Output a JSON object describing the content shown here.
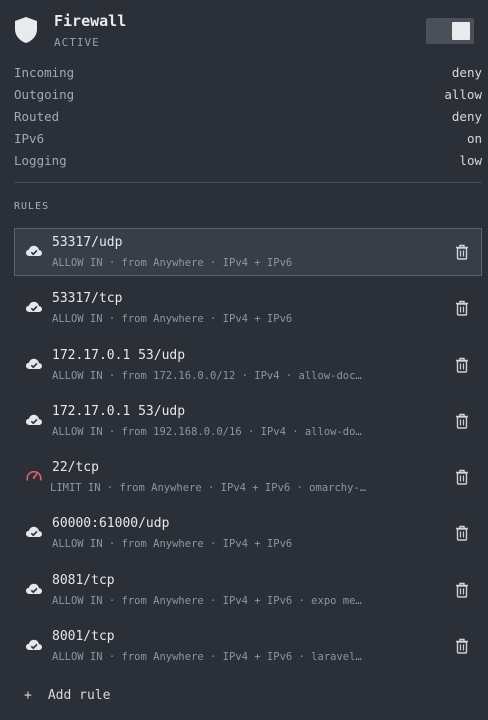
{
  "header": {
    "title": "Firewall",
    "status": "ACTIVE",
    "enabled": true
  },
  "properties": [
    {
      "key": "Incoming",
      "value": "deny"
    },
    {
      "key": "Outgoing",
      "value": "allow"
    },
    {
      "key": "Routed",
      "value": "deny"
    },
    {
      "key": "IPv6",
      "value": "on"
    },
    {
      "key": "Logging",
      "value": "low"
    }
  ],
  "rules_label": "RULES",
  "rules": [
    {
      "icon": "cloud-check-icon",
      "title": "53317/udp",
      "sub": "ALLOW IN  ·  from Anywhere  ·  IPv4 + IPv6",
      "selected": true
    },
    {
      "icon": "cloud-check-icon",
      "title": "53317/tcp",
      "sub": "ALLOW IN  ·  from Anywhere  ·  IPv4 + IPv6"
    },
    {
      "icon": "cloud-check-icon",
      "title": "172.17.0.1 53/udp",
      "sub": "ALLOW IN  ·  from 172.16.0.0/12  ·  IPv4  ·  allow-doc…"
    },
    {
      "icon": "cloud-check-icon",
      "title": "172.17.0.1 53/udp",
      "sub": "ALLOW IN  ·  from 192.168.0.0/16  ·  IPv4  ·  allow-do…"
    },
    {
      "icon": "speedometer-icon",
      "title": "22/tcp",
      "sub": "LIMIT IN  ·  from Anywhere  ·  IPv4 + IPv6  ·  omarchy-…",
      "limit": true
    },
    {
      "icon": "cloud-check-icon",
      "title": "60000:61000/udp",
      "sub": "ALLOW IN  ·  from Anywhere  ·  IPv4 + IPv6"
    },
    {
      "icon": "cloud-check-icon",
      "title": "8081/tcp",
      "sub": "ALLOW IN  ·  from Anywhere  ·  IPv4 + IPv6  ·  expo me…"
    },
    {
      "icon": "cloud-check-icon",
      "title": "8001/tcp",
      "sub": "ALLOW IN  ·  from Anywhere  ·  IPv4 + IPv6  ·  laravel…"
    }
  ],
  "add_rule": {
    "icon": "+",
    "label": "Add rule"
  },
  "colors": {
    "background": "#2a2f38",
    "limit_icon": "#e0626a",
    "text": "#d6d9de"
  }
}
